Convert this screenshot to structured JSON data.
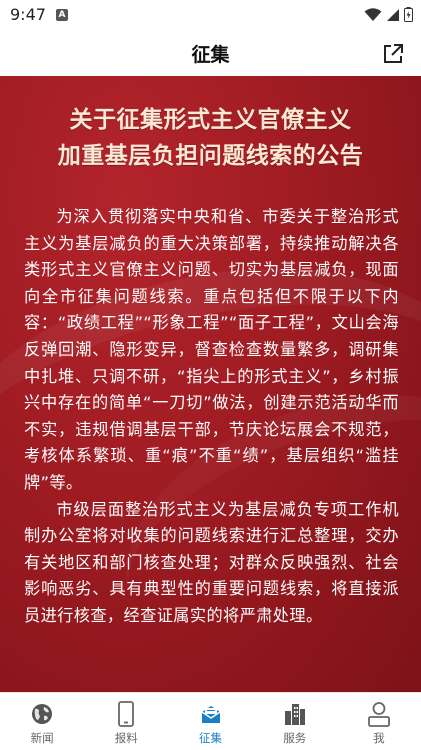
{
  "status": {
    "time": "9:47",
    "notif_badge": "A"
  },
  "header": {
    "title": "征集"
  },
  "article": {
    "headline_lines": [
      "关于征集形式主义官僚主义",
      "加重基层负担问题线索的公告"
    ],
    "paragraphs": [
      "为深入贯彻落实中央和省、市委关于整治形式主义为基层减负的重大决策部署，持续推动解决各类形式主义官僚主义问题、切实为基层减负，现面向全市征集问题线索。重点包括但不限于以下内容：“政绩工程”“形象工程”“面子工程”，文山会海反弹回潮、隐形变异，督查检查数量繁多，调研集中扎堆、只调不研，“指尖上的形式主义”，乡村振兴中存在的简单“一刀切”做法，创建示范活动华而不实，违规借调基层干部，节庆论坛展会不规范，考核体系繁琐、重“痕”不重“绩”，基层组织“滥挂牌”等。",
      "市级层面整治形式主义为基层减负专项工作机制办公室将对收集的问题线索进行汇总整理，交办有关地区和部门核查处理；对群众反映强烈、社会影响恶劣、具有典型性的重要问题线索，将直接派员进行核查，经查证属实的将严肃处理。"
    ]
  },
  "tabs": [
    {
      "label": "新闻",
      "icon": "globe-icon",
      "active": false
    },
    {
      "label": "报料",
      "icon": "phone-icon",
      "active": false
    },
    {
      "label": "征集",
      "icon": "envelope-icon",
      "active": true
    },
    {
      "label": "服务",
      "icon": "buildings-icon",
      "active": false
    },
    {
      "label": "我",
      "icon": "person-icon",
      "active": false
    }
  ],
  "colors": {
    "accent": "#1a7fc4",
    "banner": "#9e1b22",
    "headline": "#fbe9d6"
  }
}
